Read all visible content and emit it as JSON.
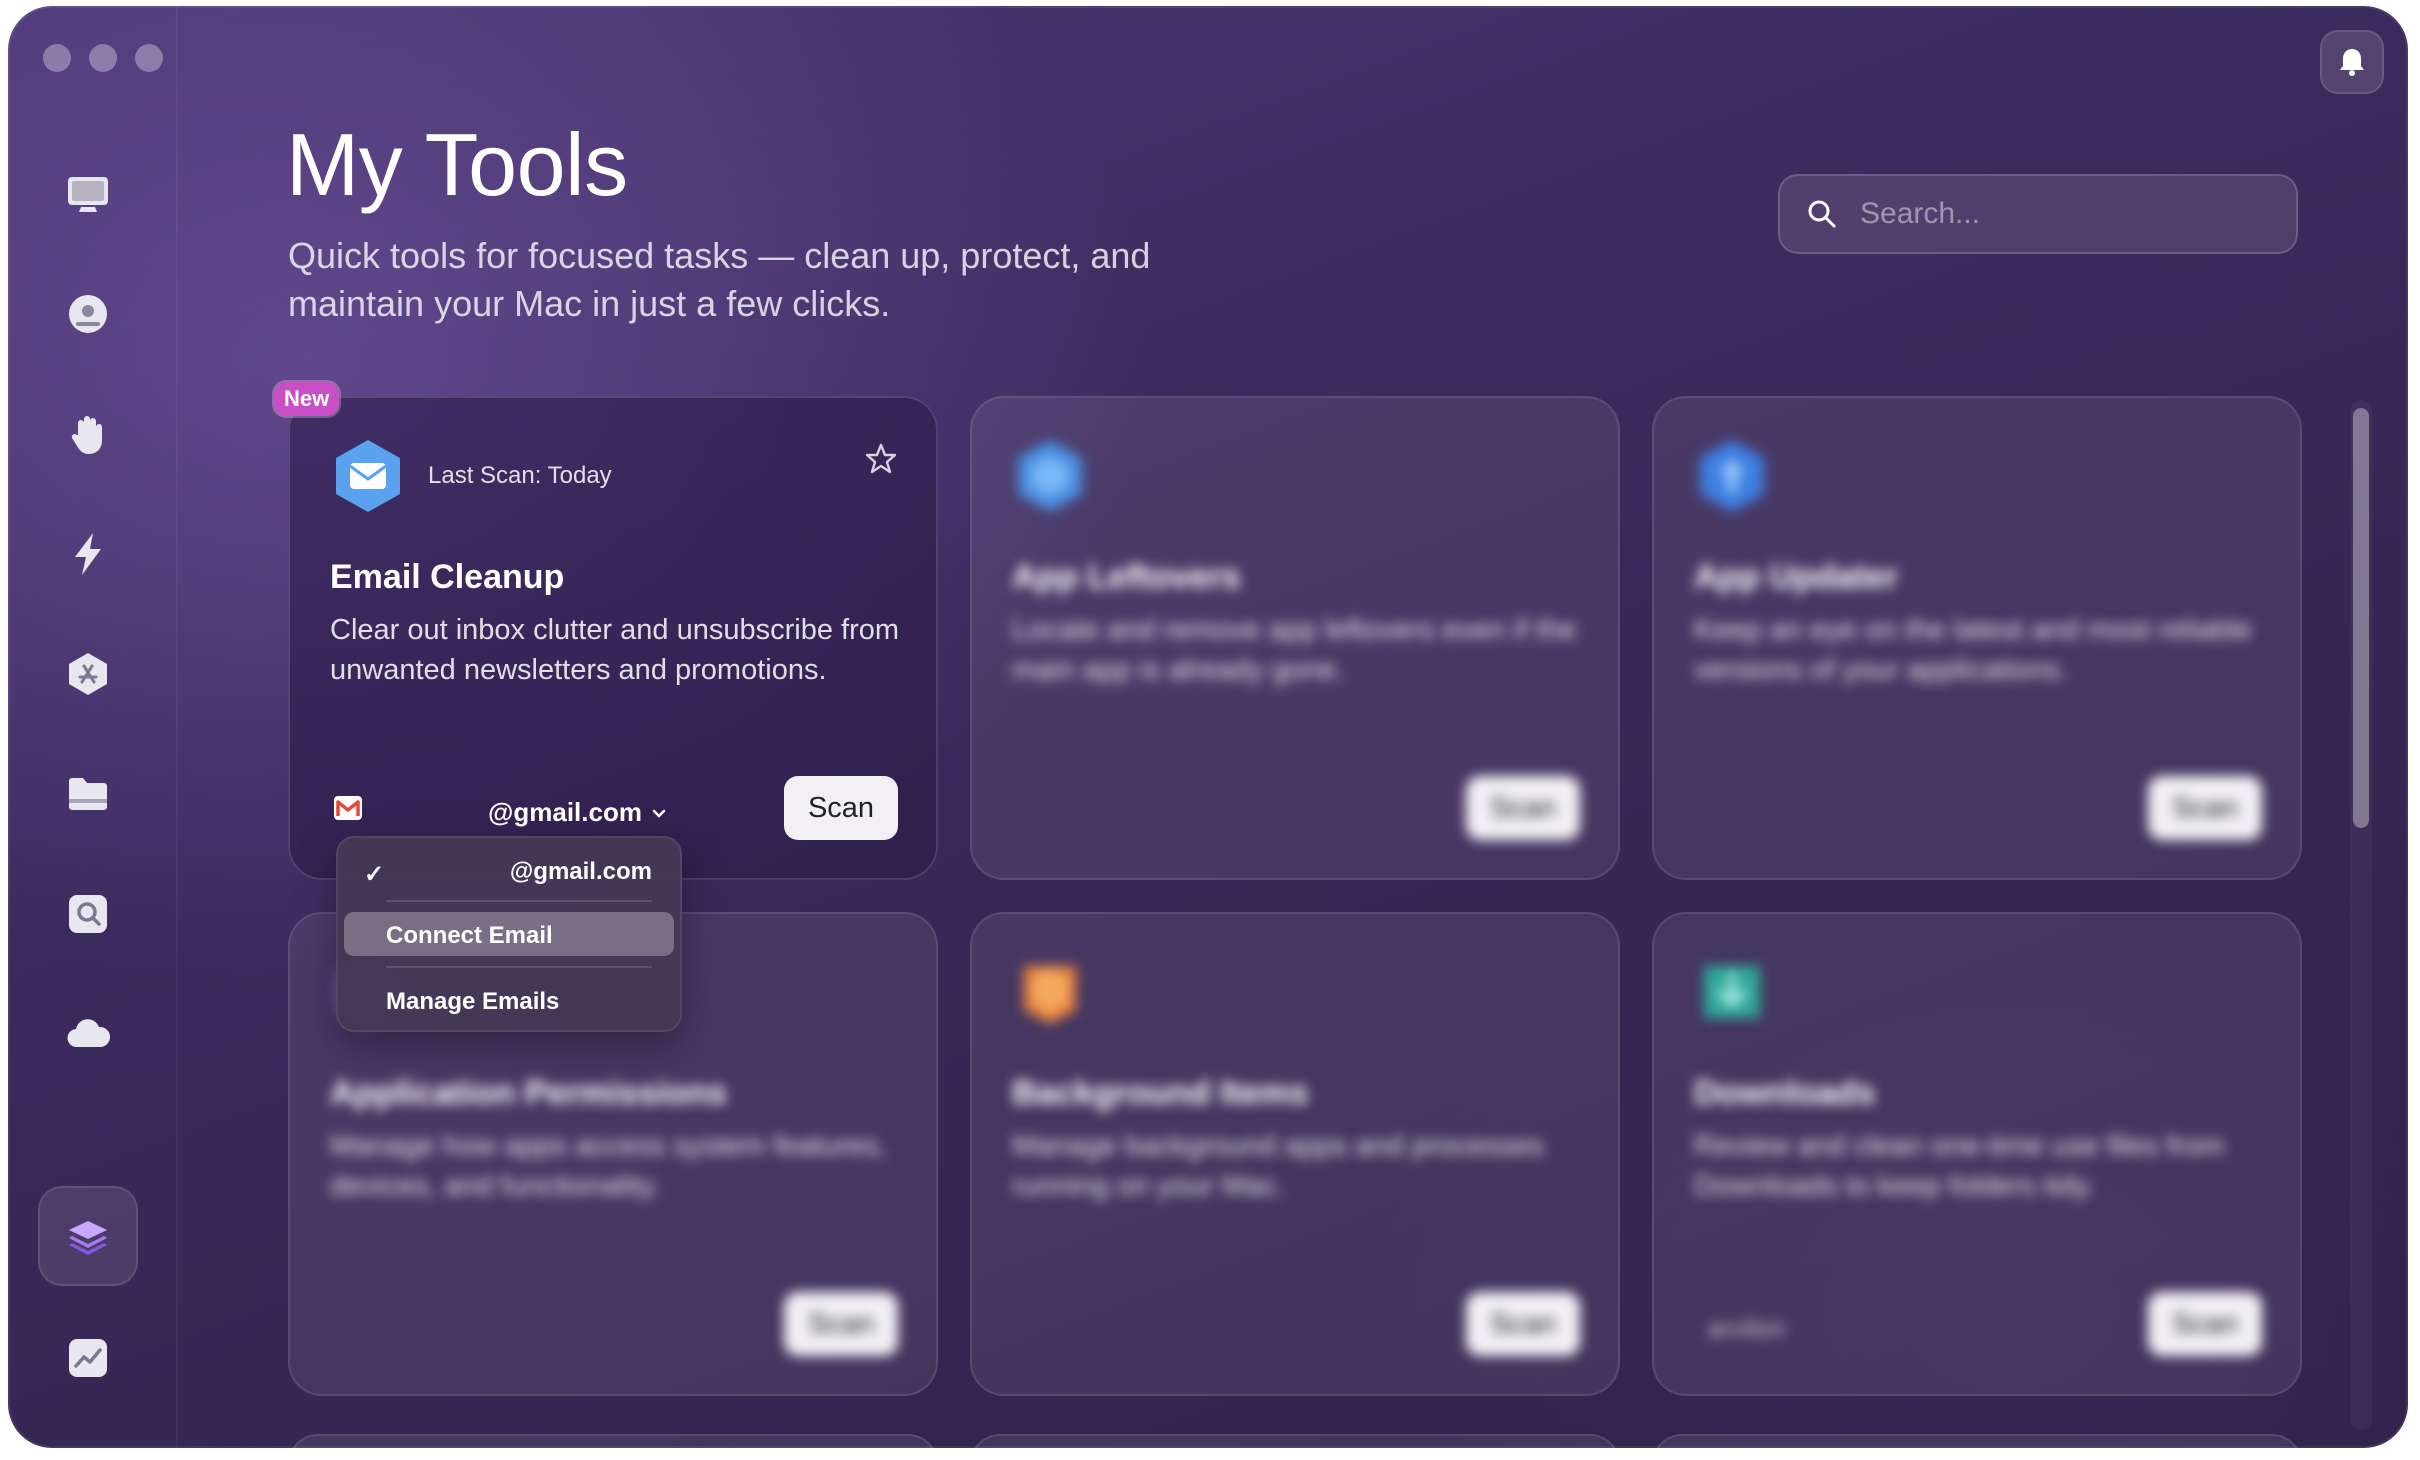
{
  "header": {
    "title": "My Tools",
    "subtitle": "Quick tools for focused tasks — clean up, protect, and maintain your Mac in just a few clicks.",
    "search_placeholder": "Search..."
  },
  "sidebar": {
    "items": [
      {
        "icon": "desktop-icon"
      },
      {
        "icon": "disk-icon"
      },
      {
        "icon": "hand-icon"
      },
      {
        "icon": "lightning-icon"
      },
      {
        "icon": "app-store-icon"
      },
      {
        "icon": "folder-icon"
      },
      {
        "icon": "magnifier-icon"
      },
      {
        "icon": "cloud-icon"
      },
      {
        "icon": "layers-icon",
        "active": true
      },
      {
        "icon": "chart-icon"
      }
    ]
  },
  "cards": [
    {
      "title": "Email Cleanup",
      "description": "Clear out inbox clutter and unsubscribe from unwanted newsletters and promotions.",
      "last_scan": "Last Scan: Today",
      "badge": "New",
      "account": "@gmail.com",
      "scan_label": "Scan",
      "icon": "mail-icon",
      "color": "#5aa2f0"
    },
    {
      "title": "App Leftovers",
      "description": "Locate and remove app leftovers even if the main app is already gone.",
      "scan_label": "Scan",
      "icon": "hexagon-icon",
      "color": "#4a8fe0"
    },
    {
      "title": "App Updater",
      "description": "Keep an eye on the latest and most reliable versions of your applications.",
      "scan_label": "Scan",
      "icon": "update-icon",
      "color": "#3d7fe0"
    },
    {
      "title": "Application Permissions",
      "description": "Manage how apps access system features, devices, and functionality.",
      "scan_label": "Scan",
      "icon": "permissions-icon",
      "color": "#7a62c8"
    },
    {
      "title": "Background Items",
      "description": "Manage background apps and processes running on your Mac.",
      "scan_label": "Scan",
      "icon": "background-icon",
      "color": "#e8803a"
    },
    {
      "title": "Downloads",
      "description": "Review and clean one-time use files from Downloads to keep folders tidy.",
      "scan_label": "Scan",
      "icon": "downloads-icon",
      "color": "#2fa89a",
      "account": "arvilon"
    }
  ],
  "dropdown": {
    "items": [
      {
        "label": "@gmail.com",
        "checked": true
      },
      {
        "label": "Connect Email",
        "highlighted": true
      },
      {
        "label": "Manage Emails"
      }
    ]
  }
}
